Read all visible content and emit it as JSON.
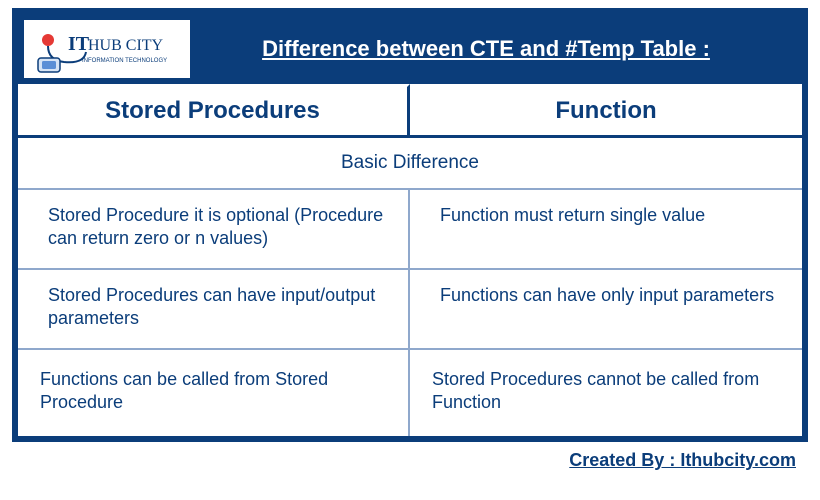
{
  "brand": {
    "name": "IT HUB CITY",
    "subtitle": "INFORMATION TECHNOLOGY"
  },
  "title": "Difference between CTE and #Temp Table :",
  "columns": {
    "left": "Stored Procedures",
    "right": "Function"
  },
  "section_title": "Basic Difference",
  "rows": [
    {
      "left": "Stored Procedure it is optional (Procedure can return zero or n values)",
      "right": "Function must return single value"
    },
    {
      "left": "Stored Procedures can have input/output parameters",
      "right": "Functions can have only input parameters"
    },
    {
      "left": "Functions can be called from Stored Procedure",
      "right": "Stored Procedures cannot be called from Function"
    }
  ],
  "footer": {
    "label": "Created By : Ithubcity.com"
  },
  "colors": {
    "primary": "#0b3d7a",
    "divider": "#8fa8cc"
  }
}
